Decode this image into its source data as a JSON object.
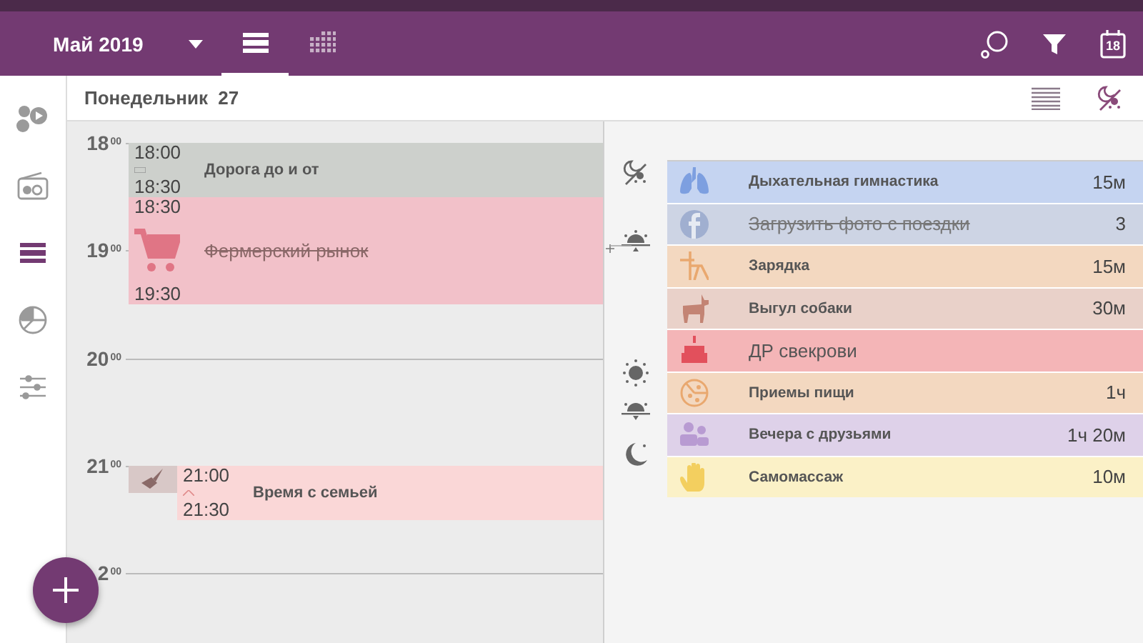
{
  "app_bar": {
    "month": "Май 2019",
    "views": [
      {
        "kind": "list",
        "selected": true
      },
      {
        "kind": "grid",
        "selected": false
      }
    ],
    "calendar_day": "18"
  },
  "sidebar": {
    "items": [
      {
        "kind": "apps",
        "selected": false
      },
      {
        "kind": "radio",
        "selected": false
      },
      {
        "kind": "day",
        "selected": true
      },
      {
        "kind": "chart",
        "selected": false
      },
      {
        "kind": "settings",
        "selected": false
      }
    ]
  },
  "day_header": {
    "title": "Понедельник  27"
  },
  "timeline": {
    "hours": [
      {
        "hour": "18",
        "minutes": "00"
      },
      {
        "hour": "19",
        "minutes": "00"
      },
      {
        "hour": "20",
        "minutes": "00"
      },
      {
        "hour": "21",
        "minutes": "00"
      },
      {
        "hour": "2",
        "minutes": "00"
      }
    ],
    "events": [
      {
        "kind": "plain",
        "start": "18:00",
        "end": "18:30",
        "title": "Дорога до и от",
        "color": "#cdd0cc",
        "done": false
      },
      {
        "kind": "cart",
        "start": "18:30",
        "end": "19:30",
        "title": "Фермерский рынок",
        "color": "#f2c1c9",
        "done": true
      },
      {
        "kind": "broom",
        "start": "21:00",
        "end": "21:30",
        "title": "Время с семьей",
        "color": "#fad7d7",
        "done": false
      }
    ]
  },
  "tasks": [
    {
      "kind": "lungs",
      "name": "Дыхательная гимнастика",
      "duration": "15м",
      "color": "#c5d4f1",
      "done": false,
      "all_day": false
    },
    {
      "kind": "facebook",
      "name": "Загрузить фото с поездки",
      "duration": "3",
      "color": "#cdd4e4",
      "done": true,
      "all_day": false
    },
    {
      "kind": "exercise",
      "name": "Зарядка",
      "duration": "15м",
      "color": "#f3d8c0",
      "done": false,
      "all_day": false
    },
    {
      "kind": "dog",
      "name": "Выгул собаки",
      "duration": "30м",
      "color": "#e9d1c9",
      "done": false,
      "all_day": false
    },
    {
      "kind": "cake",
      "name": "ДР свекрови",
      "color": "#f4b5b7",
      "done": false,
      "all_day": true
    },
    {
      "kind": "pizza",
      "name": "Приемы пищи",
      "duration": "1ч",
      "color": "#f3d8c0",
      "done": false,
      "all_day": false
    },
    {
      "kind": "people",
      "name": "Вечера с друзьями",
      "duration": "1ч 20м",
      "color": "#ded1e9",
      "done": false,
      "all_day": false
    },
    {
      "kind": "hand",
      "name": "Самомассаж",
      "duration": "10м",
      "color": "#fbf1c7",
      "done": false,
      "all_day": false
    }
  ]
}
